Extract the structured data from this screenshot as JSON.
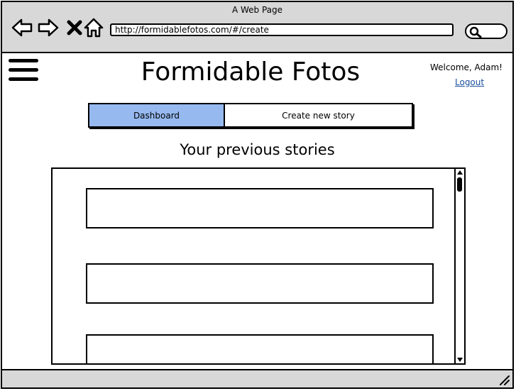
{
  "window": {
    "title": "A Web Page"
  },
  "browser": {
    "url": "http://formidablefotos.com/#/create",
    "icons": [
      "back-arrow-icon",
      "forward-arrow-icon",
      "close-icon",
      "home-icon",
      "search-icon"
    ]
  },
  "header": {
    "site_title": "Formidable Fotos",
    "welcome_text": "Welcome, Adam!",
    "logout_label": "Logout"
  },
  "tabs": [
    {
      "label": "Dashboard",
      "active": true
    },
    {
      "label": "Create new story",
      "active": false
    }
  ],
  "main": {
    "heading": "Your previous stories",
    "stories": [
      "",
      "",
      ""
    ]
  },
  "colors": {
    "active_tab": "#96b9f0",
    "chrome": "#d8d8d8",
    "link": "#1a4f9e"
  }
}
